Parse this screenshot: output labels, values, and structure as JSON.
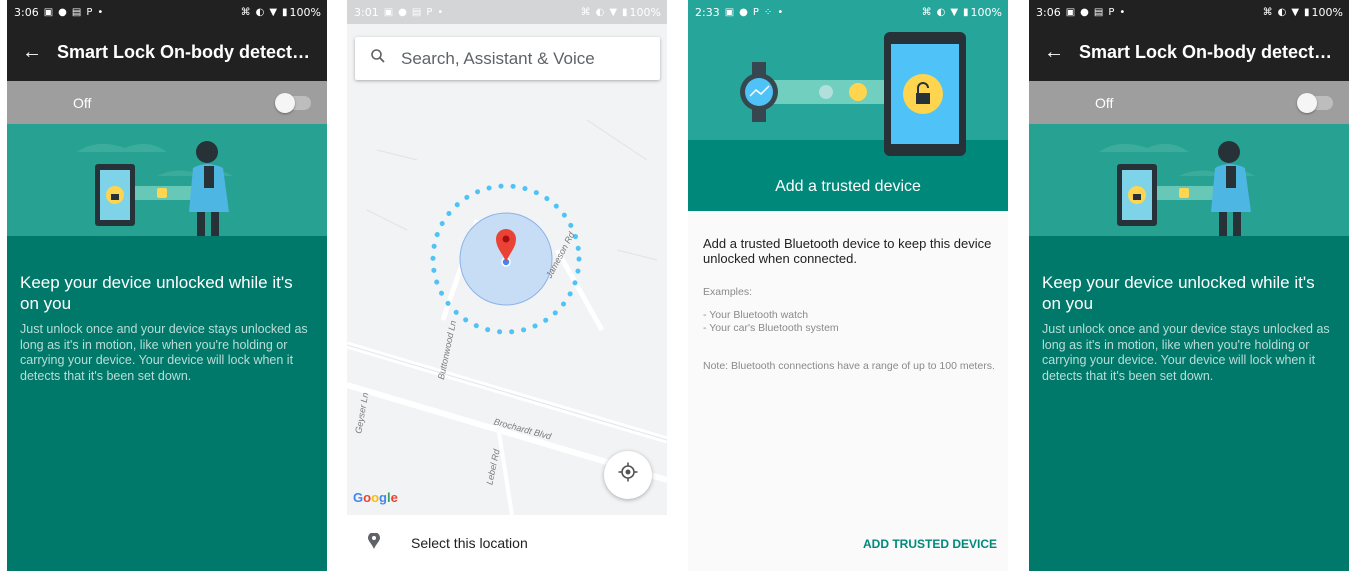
{
  "smartlock_left": {
    "status": {
      "time": "3:06",
      "battery": "100%"
    },
    "appbar": {
      "title": "Smart Lock On-body detecti…"
    },
    "toggle": {
      "label": "Off"
    },
    "headline": "Keep your device unlocked while it's on you",
    "body": "Just unlock once and your device stays unlocked as long as it's in motion, like when you're holding or carrying your device. Your device will lock when it detects that it's been set down."
  },
  "maps": {
    "status": {
      "time": "3:01",
      "battery": "100%"
    },
    "search": {
      "placeholder": "Search, Assistant & Voice"
    },
    "streets": [
      "Jameson Rd",
      "Buttonwood Ln",
      "Brochardt Blvd",
      "Lebel Rd",
      "Geyser Ln"
    ],
    "logo": "Google",
    "select_label": "Select this location"
  },
  "trusted_device": {
    "status": {
      "time": "2:33",
      "battery": "100%"
    },
    "title": "Add a trusted device",
    "lead": "Add a trusted Bluetooth device to keep this device unlocked when connected.",
    "examples_label": "Examples:",
    "example_1": "- Your Bluetooth watch",
    "example_2": "- Your car's Bluetooth system",
    "note": "Note: Bluetooth connections have a range of up to 100 meters.",
    "button": "ADD TRUSTED DEVICE"
  },
  "smartlock_right": {
    "status": {
      "time": "3:06",
      "battery": "100%"
    },
    "appbar": {
      "title": "Smart Lock On-body detecti…"
    },
    "toggle": {
      "label": "Off"
    },
    "headline": "Keep your device unlocked while it's on you",
    "body": "Just unlock once and your device stays unlocked as long as it's in motion, like when you're holding or carrying your device. Your device will lock when it detects that it's been set down."
  },
  "colors": {
    "teal_dark": "#00796b",
    "teal_light": "#27a191",
    "appbar": "#212121",
    "toggle_row": "#9e9e9e",
    "accent": "#00897b",
    "map_pin": "#ea4335"
  },
  "icons": {
    "back": "arrow-back-icon",
    "search": "search-icon",
    "pin": "location-pin-icon",
    "locate": "my-location-icon"
  }
}
